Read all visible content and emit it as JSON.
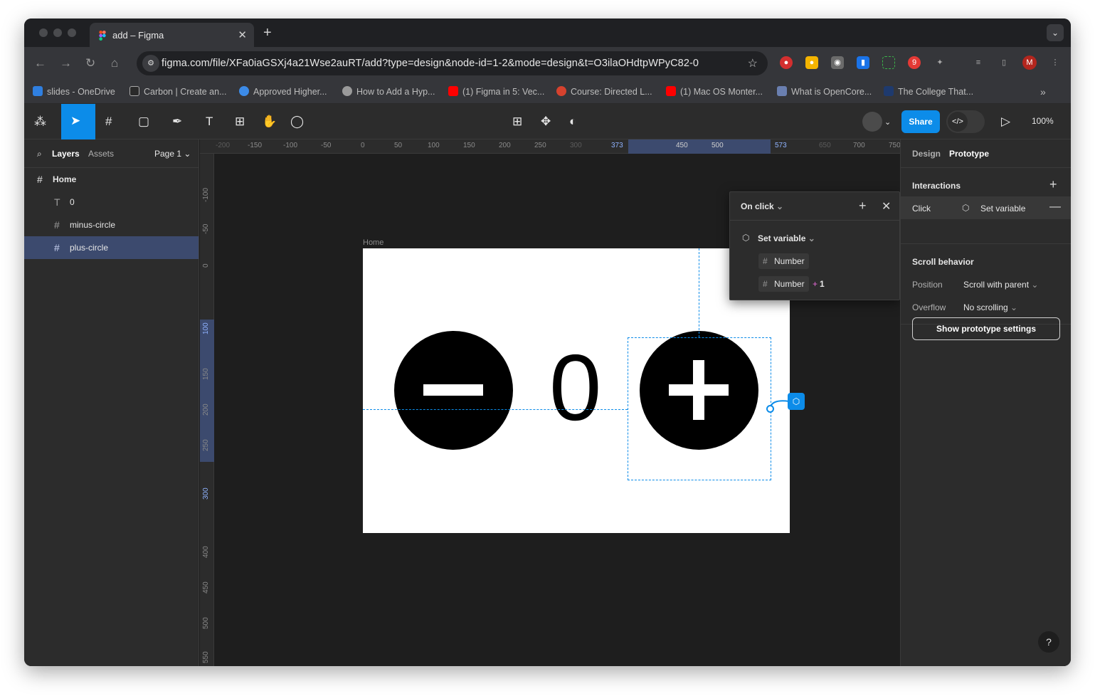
{
  "browser": {
    "tab_title": "add – Figma",
    "tab_close": "✕",
    "new_tab": "+",
    "url": "figma.com/file/XFa0iaGSXj4a21Wse2auRT/add?type=design&node-id=1-2&mode=design&t=O3ilaOHdtpWPyC82-0",
    "profile_initial": "M",
    "extension_badge": "9",
    "bookmarks": [
      {
        "label": "slides - OneDrive",
        "color": "#2f7fe0"
      },
      {
        "label": "Carbon | Create an...",
        "color": "#2a2a2a"
      },
      {
        "label": "Approved Higher...",
        "color": "#3c8be8"
      },
      {
        "label": "How to Add a Hyp...",
        "color": "#9a9a9a"
      },
      {
        "label": "(1) Figma in 5: Vec...",
        "color": "#ff0000"
      },
      {
        "label": "Course: Directed L...",
        "color": "#d6422e"
      },
      {
        "label": "(1) Mac OS Monter...",
        "color": "#ff0000"
      },
      {
        "label": "What is OpenCore...",
        "color": "#6a7fb0"
      },
      {
        "label": "The College That...",
        "color": "#1e3a6e"
      }
    ]
  },
  "toolbar": {
    "share_label": "Share",
    "zoom_label": "100%",
    "accent": "#0c8ce9"
  },
  "left_panel": {
    "tab_layers": "Layers",
    "tab_assets": "Assets",
    "page_label": "Page 1",
    "layers": [
      {
        "label": "Home",
        "icon": "frame-icon"
      },
      {
        "label": "0",
        "icon": "text-icon"
      },
      {
        "label": "minus-circle",
        "icon": "frame-icon"
      },
      {
        "label": "plus-circle",
        "icon": "frame-icon"
      }
    ]
  },
  "rulers": {
    "h_ticks": [
      "-200",
      "-150",
      "-100",
      "-50",
      "0",
      "50",
      "100",
      "150",
      "200",
      "250",
      "300",
      "373",
      "450",
      "500",
      "573",
      "650",
      "700",
      "750"
    ],
    "v_ticks": [
      "-100",
      "-50",
      "0",
      "100",
      "150",
      "200",
      "250",
      "300",
      "400",
      "450",
      "500",
      "550"
    ]
  },
  "canvas": {
    "frame_label": "Home",
    "counter_text": "0"
  },
  "popup": {
    "trigger": "On click",
    "action": "Set variable",
    "target_var": "Number",
    "expr_var": "Number",
    "expr_op": "+",
    "expr_value": "1"
  },
  "right_panel": {
    "tab_design": "Design",
    "tab_prototype": "Prototype",
    "interactions_title": "Interactions",
    "interaction_trigger": "Click",
    "interaction_action": "Set variable",
    "scroll_title": "Scroll behavior",
    "position_label": "Position",
    "position_value": "Scroll with parent",
    "overflow_label": "Overflow",
    "overflow_value": "No scrolling",
    "prototype_settings_button": "Show prototype settings",
    "help": "?"
  }
}
